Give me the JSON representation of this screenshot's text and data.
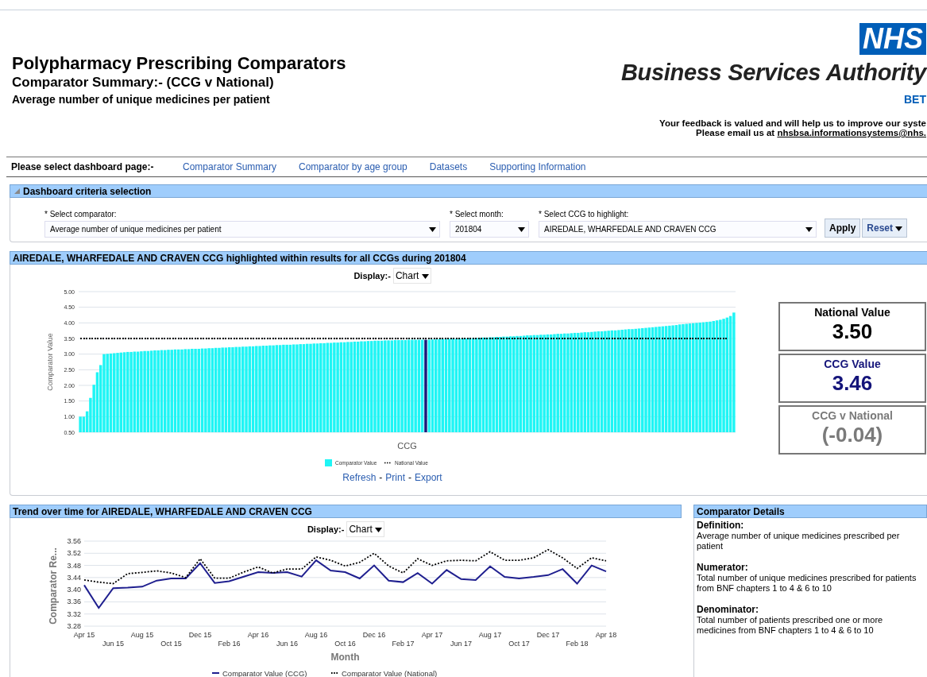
{
  "header": {
    "title": "Polypharmacy Prescribing Comparators",
    "subtitle": "Comparator Summary:- (CCG v National)",
    "measure": "Average number of unique medicines per patient",
    "logo": {
      "badge": "NHS",
      "name": "Business Services Authority",
      "tagline": "BET"
    },
    "feedback": "Your feedback is valued and will help us to improve our syste",
    "email_prefix": "Please email us at",
    "email": "nhsbsa.informationsystems@nhs."
  },
  "nav": {
    "label": "Please select dashboard page:-",
    "links": [
      "Comparator Summary",
      "Comparator by age group",
      "Datasets",
      "Supporting Information"
    ]
  },
  "criteria": {
    "title": "Dashboard criteria selection",
    "expanded": true,
    "fields": [
      {
        "label": "* Select comparator:",
        "value": "Average number of unique medicines per patient"
      },
      {
        "label": "* Select month:",
        "value": "201804"
      },
      {
        "label": "* Select CCG to highlight:",
        "value": "AIREDALE, WHARFEDALE AND CRAVEN CCG"
      }
    ],
    "buttons": [
      {
        "label": "Apply",
        "kind": "plain"
      },
      {
        "label": "Reset",
        "kind": "menu"
      }
    ]
  },
  "results": {
    "title": "AIREDALE, WHARFEDALE AND CRAVEN CCG highlighted within results for all CCGs during 201804",
    "display_label": "Display:-",
    "display_value": "Chart",
    "chart_data": {
      "type": "bar",
      "xlabel": "CCG",
      "ylabel": "Comparator Value",
      "ylim": [
        0.5,
        5
      ],
      "grid": true,
      "legend": true,
      "yticks": [
        {
          "value": 0.5,
          "label": "0.50"
        },
        {
          "value": 1,
          "label": "1.00"
        },
        {
          "value": 1.5,
          "label": "1.50"
        },
        {
          "value": 2,
          "label": "2.00"
        },
        {
          "value": 2.5,
          "label": "2.50"
        },
        {
          "value": 3,
          "label": "3.00"
        },
        {
          "value": 3.5,
          "label": "3.50"
        },
        {
          "value": 4,
          "label": "4.00"
        },
        {
          "value": 4.5,
          "label": "4.50"
        },
        {
          "value": 5,
          "label": "5.00"
        }
      ],
      "series": [
        {
          "name": "Comparator Value",
          "color": "#1ff5f5",
          "values": [
            1.0,
            1.0,
            1.17,
            1.6,
            2.02,
            2.42,
            2.65,
            3.0,
            3.01,
            3.02,
            3.03,
            3.04,
            3.05,
            3.06,
            3.07,
            3.07,
            3.08,
            3.08,
            3.09,
            3.1,
            3.1,
            3.11,
            3.12,
            3.12,
            3.13,
            3.13,
            3.14,
            3.14,
            3.15,
            3.15,
            3.15,
            3.16,
            3.16,
            3.17,
            3.17,
            3.17,
            3.18,
            3.18,
            3.19,
            3.19,
            3.2,
            3.2,
            3.21,
            3.21,
            3.22,
            3.22,
            3.23,
            3.23,
            3.24,
            3.24,
            3.25,
            3.25,
            3.26,
            3.26,
            3.27,
            3.27,
            3.28,
            3.28,
            3.29,
            3.29,
            3.3,
            3.3,
            3.3,
            3.31,
            3.31,
            3.32,
            3.32,
            3.33,
            3.33,
            3.34,
            3.34,
            3.35,
            3.35,
            3.36,
            3.36,
            3.37,
            3.37,
            3.38,
            3.38,
            3.39,
            3.39,
            3.4,
            3.4,
            3.41,
            3.41,
            3.42,
            3.42,
            3.43,
            3.43,
            3.43,
            3.44,
            3.44,
            3.44,
            3.45,
            3.45,
            3.45,
            3.45,
            3.46,
            3.46,
            3.46,
            3.46,
            3.46,
            null,
            3.46,
            3.47,
            3.47,
            3.48,
            3.48,
            3.48,
            3.49,
            3.49,
            3.49,
            3.5,
            3.5,
            3.5,
            3.51,
            3.51,
            3.52,
            3.52,
            3.53,
            3.53,
            3.54,
            3.54,
            3.55,
            3.55,
            3.56,
            3.56,
            3.57,
            3.57,
            3.58,
            3.58,
            3.59,
            3.6,
            3.6,
            3.61,
            3.61,
            3.62,
            3.62,
            3.63,
            3.63,
            3.64,
            3.65,
            3.65,
            3.66,
            3.66,
            3.67,
            3.68,
            3.68,
            3.69,
            3.7,
            3.7,
            3.71,
            3.72,
            3.73,
            3.73,
            3.74,
            3.75,
            3.76,
            3.76,
            3.77,
            3.78,
            3.79,
            3.8,
            3.8,
            3.81,
            3.82,
            3.83,
            3.84,
            3.85,
            3.86,
            3.87,
            3.88,
            3.89,
            3.9,
            3.91,
            3.92,
            3.93,
            3.95,
            3.96,
            3.97,
            3.98,
            3.99,
            4.0,
            4.01,
            4.02,
            4.03,
            4.04,
            4.06,
            4.08,
            4.1,
            4.13,
            4.17,
            4.22,
            4.33
          ]
        },
        {
          "name": "National Value",
          "type": "line",
          "line_style": "dotted",
          "color": "#000000",
          "values": [
            3.5,
            3.5,
            3.5,
            3.5,
            3.5,
            3.5,
            3.5,
            3.5,
            3.5,
            3.5,
            3.5,
            3.5,
            3.5,
            3.5,
            3.5,
            3.5,
            3.5,
            3.5,
            3.5,
            3.5,
            3.5,
            3.5,
            3.5,
            3.5,
            3.5,
            3.5,
            3.5,
            3.5,
            3.5,
            3.5,
            3.5,
            3.5,
            3.5,
            3.5,
            3.5,
            3.5,
            3.5,
            3.5,
            3.5,
            3.5,
            3.5,
            3.5,
            3.5,
            3.5,
            3.5,
            3.5,
            3.5,
            3.5,
            3.5,
            3.5,
            3.5,
            3.5,
            3.5,
            3.5,
            3.5,
            3.5,
            3.5,
            3.5,
            3.5,
            3.5,
            3.5,
            3.5,
            3.5,
            3.5,
            3.5,
            3.5,
            3.5,
            3.5,
            3.5,
            3.5,
            3.5,
            3.5,
            3.5,
            3.5,
            3.5,
            3.5,
            3.5,
            3.5,
            3.5,
            3.5,
            3.5,
            3.5,
            3.5,
            3.5,
            3.5,
            3.5,
            3.5,
            3.5,
            3.5,
            3.5,
            3.5,
            3.5,
            3.5,
            3.5,
            3.5,
            3.5,
            3.5,
            3.5,
            3.5,
            3.5,
            3.5,
            3.5,
            3.5,
            3.5,
            3.5,
            3.5,
            3.5,
            3.5,
            3.5,
            3.5,
            3.5,
            3.5,
            3.5,
            3.5,
            3.5,
            3.5,
            3.5,
            3.5,
            3.5,
            3.5,
            3.5,
            3.5,
            3.5,
            3.5,
            3.5,
            3.5,
            3.5,
            3.5,
            3.5,
            3.5,
            3.5,
            3.5,
            3.5,
            3.5,
            3.5,
            3.5,
            3.5,
            3.5,
            3.5,
            3.5,
            3.5,
            3.5,
            3.5,
            3.5,
            3.5,
            3.5,
            3.5,
            3.5,
            3.5,
            3.5,
            3.5,
            3.5,
            3.5,
            3.5,
            3.5,
            3.5,
            3.5,
            3.5,
            3.5,
            3.5,
            3.5,
            3.5,
            3.5,
            3.5,
            3.5,
            3.5,
            3.5,
            3.5,
            3.5,
            3.5,
            3.5,
            3.5,
            3.5,
            3.5,
            3.5,
            3.5,
            3.5,
            3.5,
            3.5,
            3.5,
            3.5,
            3.5,
            3.5,
            3.5,
            3.5,
            3.5,
            3.5,
            3.5,
            3.5,
            3.5,
            3.5,
            3.5
          ]
        },
        {
          "color": "#1a1a7a",
          "values": [
            null,
            null,
            null,
            null,
            null,
            null,
            null,
            null,
            null,
            null,
            null,
            null,
            null,
            null,
            null,
            null,
            null,
            null,
            null,
            null,
            null,
            null,
            null,
            null,
            null,
            null,
            null,
            null,
            null,
            null,
            null,
            null,
            null,
            null,
            null,
            null,
            null,
            null,
            null,
            null,
            null,
            null,
            null,
            null,
            null,
            null,
            null,
            null,
            null,
            null,
            null,
            null,
            null,
            null,
            null,
            null,
            null,
            null,
            null,
            null,
            null,
            null,
            null,
            null,
            null,
            null,
            null,
            null,
            null,
            null,
            null,
            null,
            null,
            null,
            null,
            null,
            null,
            null,
            null,
            null,
            null,
            null,
            null,
            null,
            null,
            null,
            null,
            null,
            null,
            null,
            null,
            null,
            null,
            null,
            null,
            null,
            null,
            null,
            null,
            null,
            null,
            null,
            3.46,
            null,
            null,
            null,
            null,
            null,
            null,
            null,
            null,
            null,
            null,
            null,
            null,
            null,
            null,
            null,
            null,
            null,
            null,
            null,
            null,
            null,
            null,
            null,
            null,
            null,
            null,
            null,
            null,
            null,
            null,
            null,
            null,
            null,
            null,
            null,
            null,
            null,
            null,
            null,
            null,
            null,
            null,
            null,
            null,
            null,
            null,
            null,
            null,
            null,
            null,
            null,
            null,
            null,
            null,
            null,
            null,
            null,
            null,
            null,
            null,
            null,
            null,
            null,
            null,
            null,
            null,
            null,
            null,
            null,
            null,
            null,
            null,
            null,
            null,
            null,
            null,
            null,
            null,
            null,
            null,
            null,
            null,
            null,
            null,
            null,
            null,
            null,
            null,
            null,
            null,
            null,
            null
          ]
        }
      ]
    },
    "links": [
      "Refresh",
      "Print",
      "Export"
    ],
    "separator": "-"
  },
  "kpis": [
    {
      "kind": "national",
      "label": "National Value",
      "value": "3.50"
    },
    {
      "kind": "ccg",
      "label": "CCG Value",
      "value": "3.46"
    },
    {
      "kind": "difference",
      "label": "CCG v National",
      "value": "(-0.04)"
    }
  ],
  "trend": {
    "title": "Trend over time for AIREDALE, WHARFEDALE AND CRAVEN CCG",
    "display_label": "Display:-",
    "display_value": "Chart",
    "chart_data": {
      "type": "line",
      "xlabel": "Month",
      "ylabel": "Comparator Re...",
      "ylim": [
        3.28,
        3.56
      ],
      "grid": true,
      "legend": true,
      "categories": [
        "Apr 15",
        null,
        "Jun 15",
        null,
        "Aug 15",
        null,
        "Oct 15",
        null,
        "Dec 15",
        null,
        "Feb 16",
        null,
        "Apr 16",
        null,
        "Jun 16",
        null,
        "Aug 16",
        null,
        "Oct 16",
        null,
        "Dec 16",
        null,
        "Feb 17",
        null,
        "Apr 17",
        null,
        "Jun 17",
        null,
        "Aug 17",
        null,
        "Oct 17",
        null,
        "Dec 17",
        null,
        "Feb 18",
        null,
        "Apr 18"
      ],
      "yticks": [
        {
          "value": 3.28,
          "label": "3.28"
        },
        {
          "value": 3.32,
          "label": "3.32"
        },
        {
          "value": 3.36,
          "label": "3.36"
        },
        {
          "value": 3.4,
          "label": "3.40"
        },
        {
          "value": 3.44,
          "label": "3.44"
        },
        {
          "value": 3.48,
          "label": "3.48"
        },
        {
          "value": 3.52,
          "label": "3.52"
        },
        {
          "value": 3.56,
          "label": "3.56"
        }
      ],
      "series": [
        {
          "name": "Comparator Value (CCG)",
          "color": "#1f1f8f",
          "line_style": "solid",
          "values": [
            3.415,
            3.34,
            3.405,
            3.407,
            3.41,
            3.43,
            3.437,
            3.437,
            3.487,
            3.422,
            3.428,
            3.443,
            3.458,
            3.455,
            3.458,
            3.443,
            3.497,
            3.463,
            3.458,
            3.437,
            3.48,
            3.43,
            3.425,
            3.455,
            3.42,
            3.465,
            3.435,
            3.432,
            3.477,
            3.442,
            3.437,
            3.442,
            3.448,
            3.468,
            3.42,
            3.48,
            3.46
          ]
        },
        {
          "name": "Comparator Value (National)",
          "color": "#000000",
          "line_style": "dotted",
          "values": [
            3.432,
            3.425,
            3.42,
            3.453,
            3.457,
            3.462,
            3.455,
            3.44,
            3.502,
            3.438,
            3.438,
            3.458,
            3.475,
            3.455,
            3.468,
            3.468,
            3.508,
            3.497,
            3.478,
            3.49,
            3.52,
            3.478,
            3.455,
            3.502,
            3.48,
            3.495,
            3.497,
            3.495,
            3.525,
            3.497,
            3.497,
            3.505,
            3.532,
            3.505,
            3.47,
            3.505,
            3.495
          ]
        }
      ]
    }
  },
  "details": {
    "title": "Comparator Details",
    "sections": [
      {
        "heading": "Definition:",
        "text": "Average number of unique medicines prescribed per patient"
      },
      {
        "heading": "Numerator:",
        "text": "Total number of unique medicines prescribed for patients from BNF chapters 1 to 4 & 6 to 10"
      },
      {
        "heading": "Denominator:",
        "text": "Total number of patients prescribed one or more medicines from BNF chapters 1 to 4 & 6 to 10"
      }
    ]
  }
}
